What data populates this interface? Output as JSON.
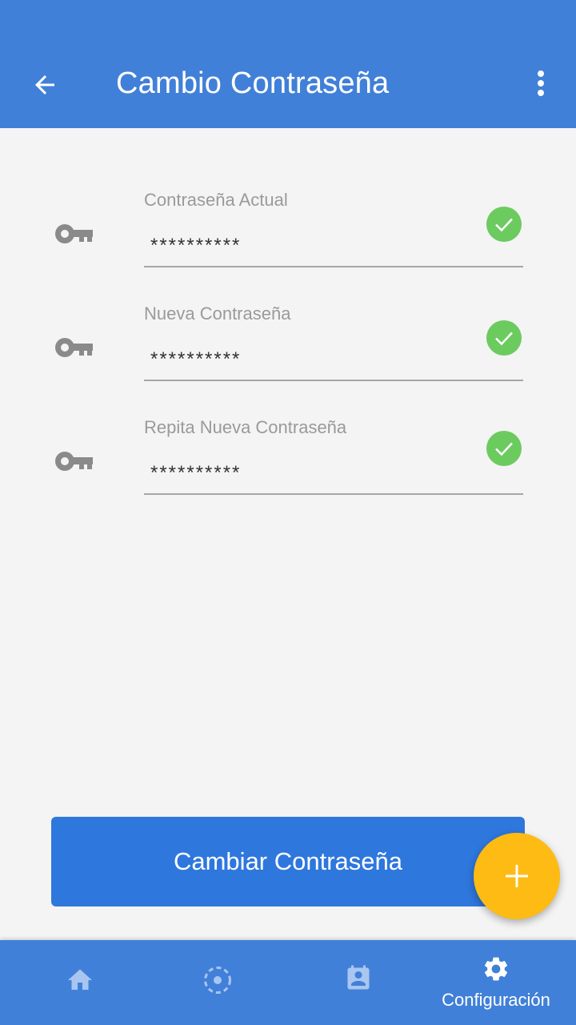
{
  "app_bar": {
    "title": "Cambio Contraseña",
    "back_icon": "arrow-back-icon",
    "more_icon": "more-vert-icon"
  },
  "form": {
    "fields": [
      {
        "label": "Contraseña Actual",
        "value": "**********",
        "icon": "key-icon",
        "status_icon": "check-circle-icon"
      },
      {
        "label": "Nueva Contraseña",
        "value": "**********",
        "icon": "key-icon",
        "status_icon": "check-circle-icon"
      },
      {
        "label": "Repita Nueva Contraseña",
        "value": "**********",
        "icon": "key-icon",
        "status_icon": "check-circle-icon"
      }
    ]
  },
  "actions": {
    "primary_label": "Cambiar Contraseña",
    "fab_icon": "plus-icon"
  },
  "bottom_nav": {
    "items": [
      {
        "icon": "home-icon",
        "label": "",
        "active": false
      },
      {
        "icon": "dashed-circle-icon",
        "label": "",
        "active": false
      },
      {
        "icon": "contact-calendar-icon",
        "label": "",
        "active": false
      },
      {
        "icon": "gear-icon",
        "label": "Configuración",
        "active": true
      }
    ]
  },
  "colors": {
    "primary": "#4180d8",
    "button": "#2e77dd",
    "fab": "#fdbb14",
    "success": "#6ccb5f",
    "background": "#f4f4f4"
  }
}
